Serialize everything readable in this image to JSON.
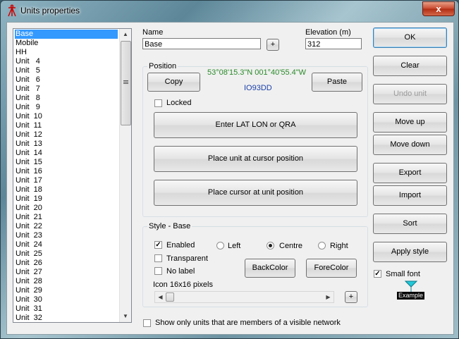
{
  "window": {
    "title": "Units properties",
    "close_label": "x"
  },
  "units_list": {
    "items": [
      "Base",
      "Mobile",
      "HH",
      "Unit   4",
      "Unit   5",
      "Unit   6",
      "Unit   7",
      "Unit   8",
      "Unit   9",
      "Unit  10",
      "Unit  11",
      "Unit  12",
      "Unit  13",
      "Unit  14",
      "Unit  15",
      "Unit  16",
      "Unit  17",
      "Unit  18",
      "Unit  19",
      "Unit  20",
      "Unit  21",
      "Unit  22",
      "Unit  23",
      "Unit  24",
      "Unit  25",
      "Unit  26",
      "Unit  27",
      "Unit  28",
      "Unit  29",
      "Unit  30",
      "Unit  31",
      "Unit  32"
    ],
    "selected_index": 0
  },
  "name": {
    "label": "Name",
    "value": "Base",
    "plus_label": "+"
  },
  "elevation": {
    "label": "Elevation (m)",
    "value": "312"
  },
  "position": {
    "title": "Position",
    "copy_label": "Copy",
    "paste_label": "Paste",
    "coords": "53°08'15.3\"N 001°40'55.4\"W",
    "locator": "IO93DD",
    "locked_label": "Locked",
    "locked": false,
    "enter_label": "Enter LAT LON or QRA",
    "place_unit_label": "Place unit at cursor position",
    "place_cursor_label": "Place cursor at unit position"
  },
  "style": {
    "title": "Style - Base",
    "enabled_label": "Enabled",
    "enabled": true,
    "transparent_label": "Transparent",
    "no_label_label": "No label",
    "left_label": "Left",
    "centre_label": "Centre",
    "right_label": "Right",
    "alignment": "Centre",
    "backcolor_label": "BackColor",
    "forecolor_label": "ForeColor",
    "icon_label": "Icon 16x16 pixels",
    "plus_label": "+"
  },
  "show_only_label": "Show only units that are members of a visible network",
  "buttons": {
    "ok": "OK",
    "clear": "Clear",
    "undo_unit": "Undo unit",
    "move_up": "Move up",
    "move_down": "Move down",
    "export": "Export",
    "import": "Import",
    "sort": "Sort",
    "apply_style": "Apply style"
  },
  "small_font": {
    "label": "Small font",
    "checked": true
  },
  "example_label": "Example",
  "colors": {
    "coords": "#2a8a2a",
    "locator": "#1a3fa8",
    "selection": "#3399ff",
    "marker": "#22c8d8"
  }
}
